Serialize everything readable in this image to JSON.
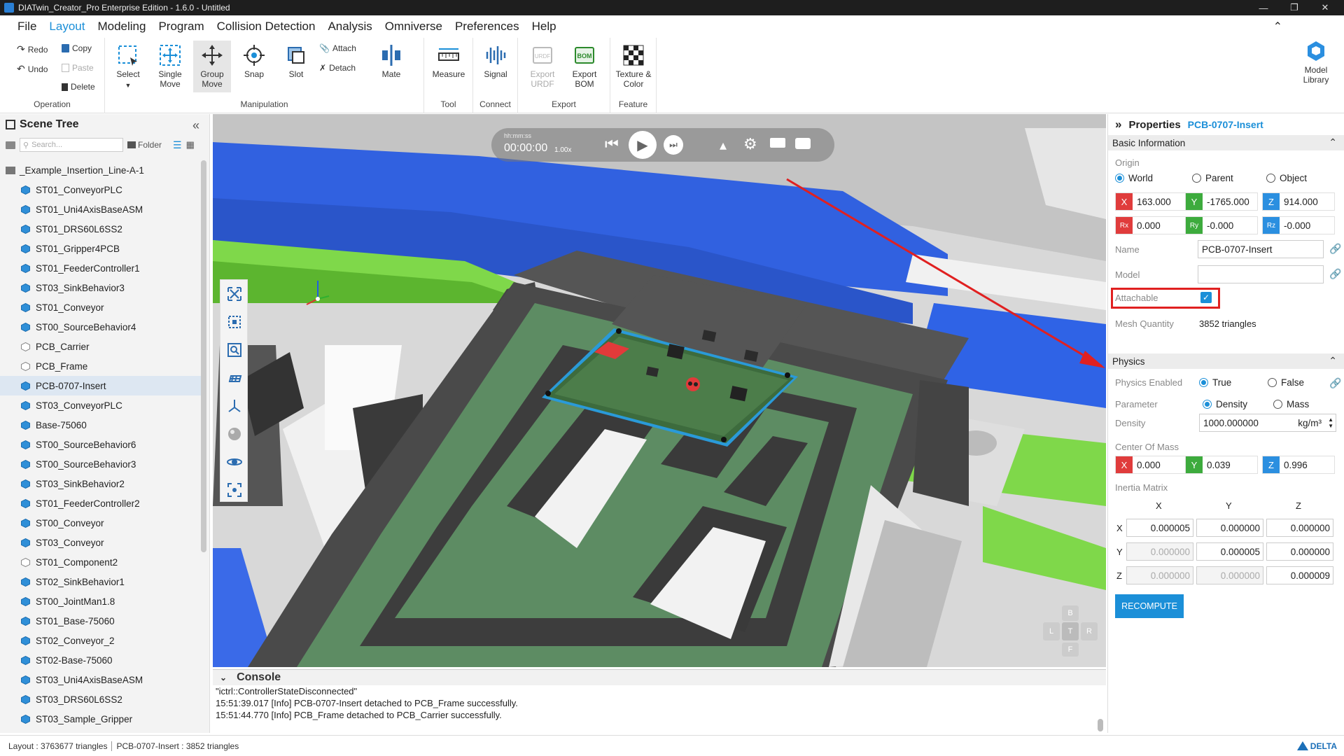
{
  "window": {
    "title": "DIATwin_Creator_Pro Enterprise Edition - 1.6.0 - Untitled"
  },
  "menu": [
    "File",
    "Layout",
    "Modeling",
    "Program",
    "Collision Detection",
    "Analysis",
    "Omniverse",
    "Preferences",
    "Help"
  ],
  "menu_active": "Layout",
  "ribbon": {
    "operation": {
      "label": "Operation",
      "redo": "Redo",
      "undo": "Undo",
      "copy": "Copy",
      "paste": "Paste",
      "delete": "Delete"
    },
    "manipulation": {
      "label": "Manipulation",
      "select": "Select",
      "single_move": "Single Move",
      "group_move": "Group Move",
      "snap": "Snap",
      "slot": "Slot",
      "attach": "Attach",
      "detach": "Detach",
      "mate": "Mate"
    },
    "tool": {
      "label": "Tool",
      "measure": "Measure"
    },
    "connect": {
      "label": "Connect",
      "signal": "Signal"
    },
    "export": {
      "label": "Export",
      "export_urdf": "Export URDF",
      "export_bom": "Export BOM"
    },
    "feature": {
      "label": "Feature",
      "texture_color": "Texture & Color"
    },
    "model_library": "Model Library"
  },
  "scene_tree": {
    "title": "Scene Tree",
    "search_placeholder": "Search...",
    "folder_label": "Folder",
    "root": "_Example_Insertion_Line-A-1",
    "items": [
      "ST01_ConveyorPLC",
      "ST01_Uni4AxisBaseASM",
      "ST01_DRS60L6SS2",
      "ST01_Gripper4PCB",
      "ST01_FeederController1",
      "ST03_SinkBehavior3",
      "ST01_Conveyor",
      "ST00_SourceBehavior4",
      "PCB_Carrier",
      "PCB_Frame",
      "PCB-0707-Insert",
      "ST03_ConveyorPLC",
      "Base-75060",
      "ST00_SourceBehavior6",
      "ST00_SourceBehavior3",
      "ST03_SinkBehavior2",
      "ST01_FeederController2",
      "ST00_Conveyor",
      "ST03_Conveyor",
      "ST01_Component2",
      "ST02_SinkBehavior1",
      "ST00_JointMan1.8",
      "ST01_Base-75060",
      "ST02_Conveyor_2",
      "ST02-Base-75060",
      "ST03_Uni4AxisBaseASM",
      "ST03_DRS60L6SS2",
      "ST03_Sample_Gripper"
    ],
    "selected": "PCB-0707-Insert"
  },
  "player": {
    "time_format": "hh:mm:ss",
    "time": "00:00:00",
    "speed": "1.00x"
  },
  "console": {
    "title": "Console",
    "lines": [
      "\"ictrl::ControllerStateDisconnected\"",
      "15:51:39.017 [Info] PCB-0707-Insert detached to PCB_Frame successfully.",
      "15:51:44.770 [Info] PCB_Frame detached to PCB_Carrier successfully."
    ]
  },
  "properties": {
    "title": "Properties",
    "object": "PCB-0707-Insert",
    "basic": {
      "section": "Basic Information",
      "origin_label": "Origin",
      "origin_options": [
        "World",
        "Parent",
        "Object"
      ],
      "origin_selected": "World",
      "x": "163.000",
      "y": "-1765.000",
      "z": "914.000",
      "rx": "0.000",
      "ry": "-0.000",
      "rz": "-0.000",
      "name_label": "Name",
      "name": "PCB-0707-Insert",
      "model_label": "Model",
      "model": "",
      "attachable_label": "Attachable",
      "attachable": true,
      "mesh_label": "Mesh Quantity",
      "mesh": "3852 triangles"
    },
    "physics": {
      "section": "Physics",
      "enabled_label": "Physics Enabled",
      "enabled_options": [
        "True",
        "False"
      ],
      "enabled_selected": "True",
      "parameter_label": "Parameter",
      "parameter_options": [
        "Density",
        "Mass"
      ],
      "parameter_selected": "Density",
      "density_label": "Density",
      "density": "1000.000000",
      "density_unit": "kg/m³",
      "com_label": "Center Of Mass",
      "com_x": "0.000",
      "com_y": "0.039",
      "com_z": "0.996",
      "inertia_label": "Inertia Matrix",
      "inertia_cols": [
        "X",
        "Y",
        "Z"
      ],
      "inertia_rows": [
        {
          "label": "X",
          "vals": [
            "0.000005",
            "0.000000",
            "0.000000"
          ]
        },
        {
          "label": "Y",
          "vals": [
            "0.000000",
            "0.000005",
            "0.000000"
          ]
        },
        {
          "label": "Z",
          "vals": [
            "0.000000",
            "0.000000",
            "0.000009"
          ]
        }
      ],
      "recompute": "RECOMPUTE"
    }
  },
  "navcube": {
    "top": "B",
    "left": "L",
    "center": "T",
    "right": "R",
    "bottom": "F"
  },
  "status": {
    "layout": "Layout : 3763677 triangles",
    "selection": "PCB-0707-Insert : 3852 triangles",
    "brand": "DELTA"
  },
  "colors": {
    "accent": "#1b8fd8",
    "x_red": "#e03c3c",
    "y_green": "#3dab3d",
    "z_blue": "#2b8fe0",
    "annotation_red": "#e02020"
  }
}
